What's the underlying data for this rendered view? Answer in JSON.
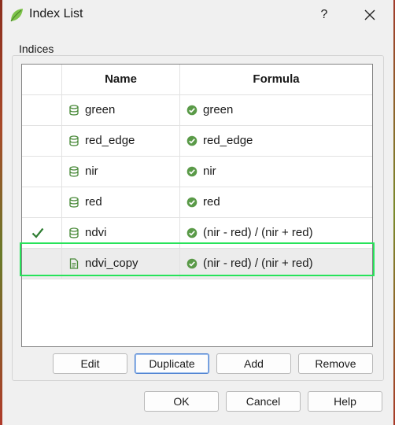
{
  "window": {
    "title": "Index List",
    "help_label": "?"
  },
  "group": {
    "label": "Indices"
  },
  "table": {
    "columns": [
      "",
      "Name",
      "Formula"
    ],
    "rows": [
      {
        "active": false,
        "selected": false,
        "name": "green",
        "formula": "green",
        "name_icon": "database-icon",
        "formula_icon": "valid-check-icon"
      },
      {
        "active": false,
        "selected": false,
        "name": "red_edge",
        "formula": "red_edge",
        "name_icon": "database-icon",
        "formula_icon": "valid-check-icon"
      },
      {
        "active": false,
        "selected": false,
        "name": "nir",
        "formula": "nir",
        "name_icon": "database-icon",
        "formula_icon": "valid-check-icon"
      },
      {
        "active": false,
        "selected": false,
        "name": "red",
        "formula": "red",
        "name_icon": "database-icon",
        "formula_icon": "valid-check-icon"
      },
      {
        "active": true,
        "selected": false,
        "name": "ndvi",
        "formula": "(nir - red) / (nir + red)",
        "name_icon": "database-icon",
        "formula_icon": "valid-check-icon"
      },
      {
        "active": false,
        "selected": true,
        "name": "ndvi_copy",
        "formula": "(nir - red) / (nir + red)",
        "name_icon": "document-icon",
        "formula_icon": "valid-check-icon"
      }
    ]
  },
  "actions": {
    "edit": "Edit",
    "duplicate": "Duplicate",
    "add": "Add",
    "remove": "Remove"
  },
  "dialog_buttons": {
    "ok": "OK",
    "cancel": "Cancel",
    "help": "Help"
  },
  "colors": {
    "accent_green": "#4a8a3a",
    "highlight": "#27e35a",
    "focus_blue": "#4a7fd0"
  }
}
